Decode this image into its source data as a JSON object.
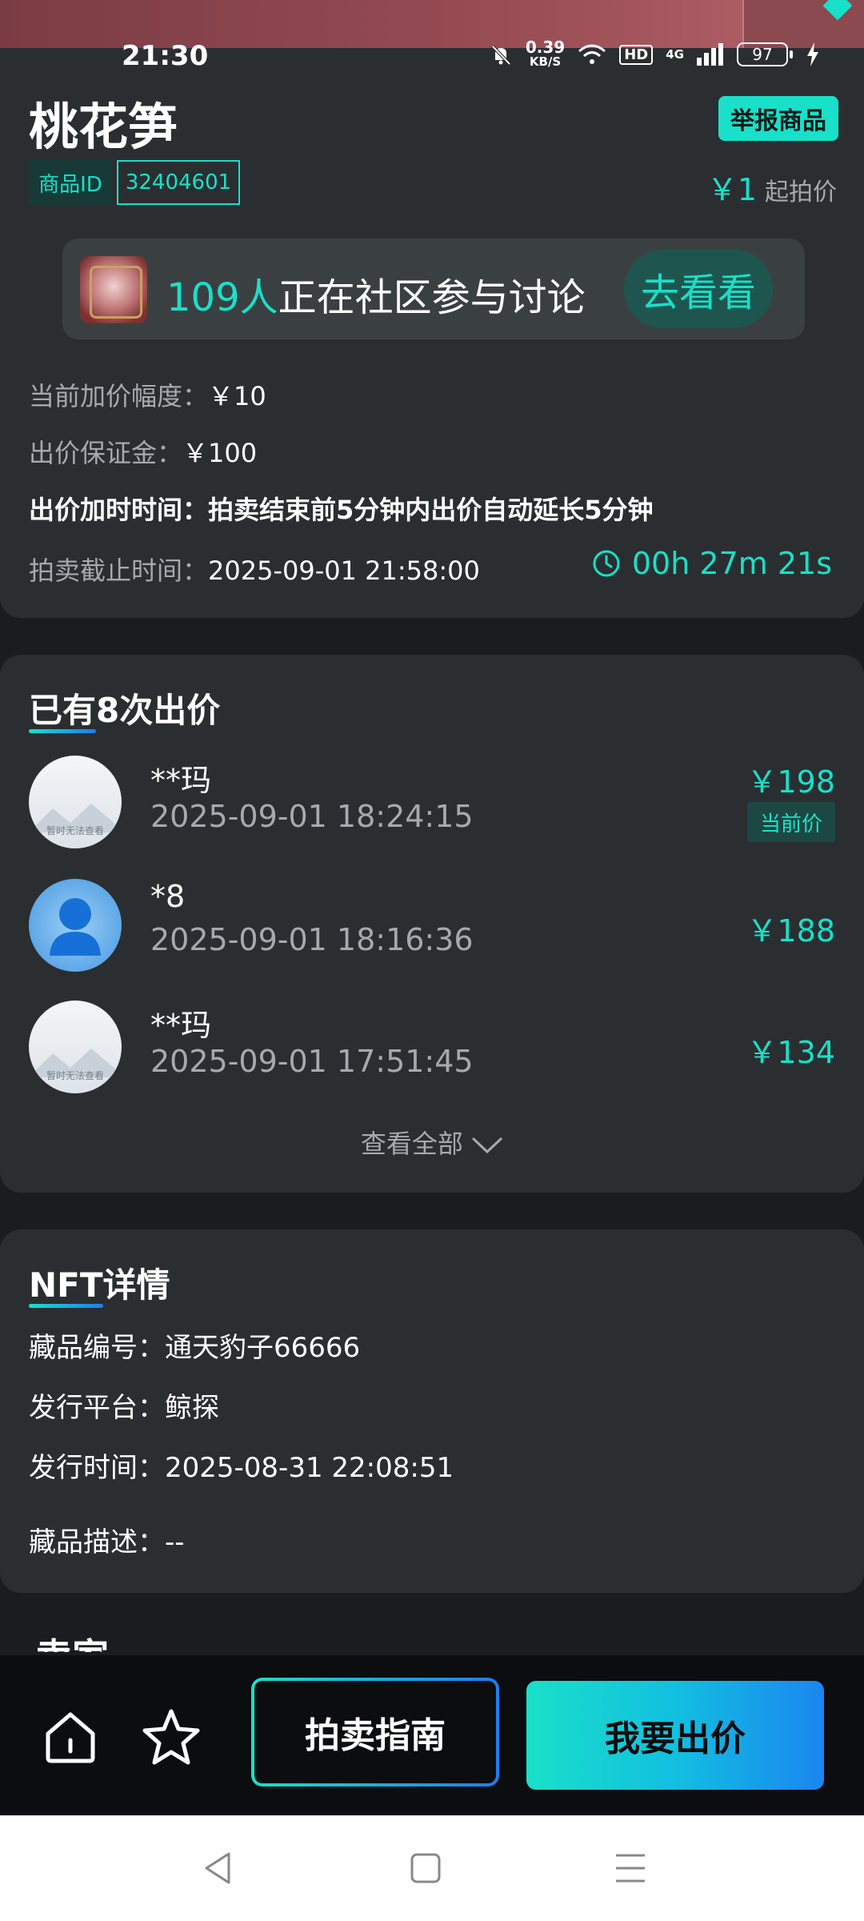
{
  "status_bar": {
    "time": "21:30",
    "net_speed_value": "0.39",
    "net_speed_unit": "KB/S",
    "hd": "HD",
    "network": "4G",
    "battery": "97"
  },
  "product": {
    "title": "桃花笋",
    "report_label": "举报商品",
    "id_label": "商品ID",
    "id_value": "32404601",
    "start_price": "￥1",
    "start_price_label": "起拍价"
  },
  "community": {
    "count": "109人",
    "text": "正在社区参与讨论",
    "button": "去看看"
  },
  "auction_info": {
    "increment_label": "当前加价幅度：",
    "increment_value": "￥10",
    "deposit_label": "出价保证金：",
    "deposit_value": "￥100",
    "extension_label": "出价加时时间：",
    "extension_value": "拍卖结束前5分钟内出价自动延长5分钟",
    "deadline_label": "拍卖截止时间：",
    "deadline_value": "2025-09-01 21:58:00",
    "countdown": "00h 27m 21s"
  },
  "bids": {
    "title_prefix": "已有",
    "title_rest": "8次出价",
    "items": [
      {
        "name": "**玛",
        "time": "2025-09-01 18:24:15",
        "price": "￥198",
        "badge": "当前价",
        "avatar": "placeholder"
      },
      {
        "name": "*8",
        "time": "2025-09-01 18:16:36",
        "price": "￥188",
        "avatar": "person"
      },
      {
        "name": "**玛",
        "time": "2025-09-01 17:51:45",
        "price": "￥134",
        "avatar": "placeholder"
      }
    ],
    "placeholder_text": "暂时无法查看",
    "view_all": "查看全部"
  },
  "nft": {
    "title_prefix": "NFT",
    "title_rest": "详情",
    "serial_label": "藏品编号：",
    "serial_value": "通天豹子66666",
    "platform_label": "发行平台：",
    "platform_value": "鲸探",
    "issue_label": "发行时间：",
    "issue_value": "2025-08-31 22:08:51",
    "desc_label": "藏品描述：",
    "desc_value": "--"
  },
  "seller": {
    "title": "卖家"
  },
  "actions": {
    "home_icon": "home-icon",
    "favorite_icon": "star-icon",
    "guide": "拍卖指南",
    "bid": "我要出价"
  },
  "colors": {
    "accent": "#19e0c9",
    "accent_blue": "#1e7df0",
    "background": "#1a1d1f",
    "card": "#2a2e30"
  }
}
